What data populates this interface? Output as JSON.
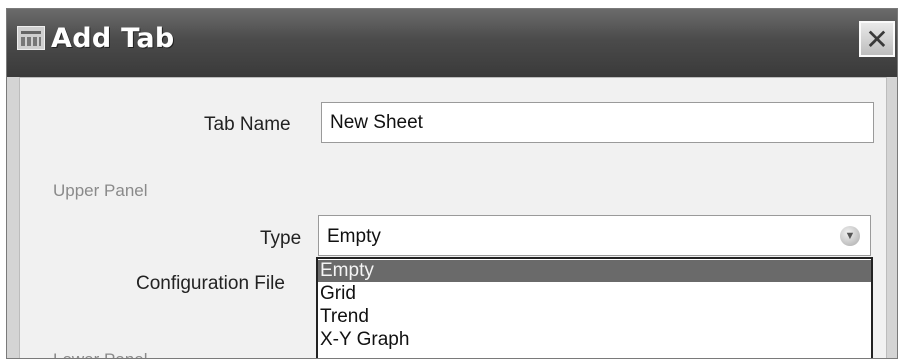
{
  "dialog": {
    "title": "Add Tab",
    "icon": "sheet-icon",
    "close_label": "✕"
  },
  "form": {
    "tab_name_label": "Tab Name",
    "tab_name_value": "New Sheet",
    "upper_panel_label": "Upper Panel",
    "type_label": "Type",
    "type_value": "Empty",
    "config_label": "Configuration File",
    "lower_panel_label": "Lower Panel"
  },
  "type_options": [
    "Empty",
    "Grid",
    "Trend",
    "X-Y Graph"
  ],
  "selected_option": "Empty"
}
